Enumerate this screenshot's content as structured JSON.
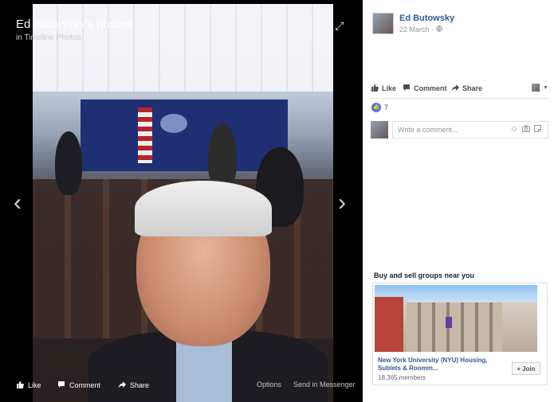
{
  "viewer": {
    "title": "Ed Butowsky's photos",
    "subtitle": "in Timeline Photos",
    "actions": {
      "like": "Like",
      "comment": "Comment",
      "share": "Share",
      "options": "Options",
      "send": "Send in Messenger"
    },
    "nav": {
      "prev": "‹",
      "next": "›"
    },
    "expand_icon": "⤢"
  },
  "post": {
    "author": "Ed Butowsky",
    "date": "22 March",
    "date_sep": " · ",
    "privacy_icon": "globe-icon",
    "actions": {
      "like": "Like",
      "comment": "Comment",
      "share": "Share"
    },
    "likes_count": "7",
    "comment_placeholder": "Write a comment..."
  },
  "ad": {
    "section_title": "Buy and sell groups near you",
    "title": "New York University (NYU) Housing, Sublets & Roomm...",
    "members": "18,365 members",
    "join_label": "Join"
  }
}
